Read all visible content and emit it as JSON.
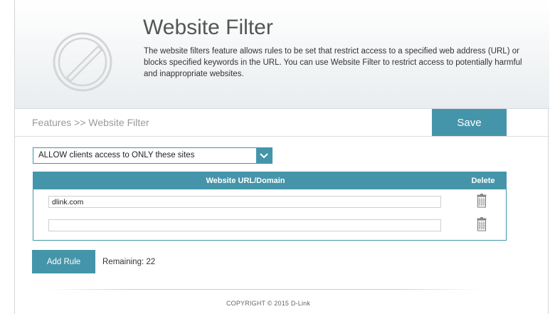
{
  "header": {
    "title": "Website Filter",
    "description": "The website filters feature allows rules to be set that restrict access to a specified web address (URL) or blocks specified keywords in the URL. You can use Website Filter to restrict access to potentially harmful and inappropriate websites.",
    "logo_icon": "prohibited-icon"
  },
  "breadcrumb": "Features >> Website Filter",
  "toolbar": {
    "save_label": "Save"
  },
  "filter_mode": {
    "selected": "ALLOW clients access to ONLY these sites",
    "arrow_icon": "chevron-down-icon"
  },
  "table": {
    "columns": [
      "Website URL/Domain",
      "Delete"
    ],
    "rows": [
      {
        "url": "dlink.com",
        "delete_icon": "trash-icon"
      },
      {
        "url": "",
        "delete_icon": "trash-icon"
      }
    ]
  },
  "actions": {
    "add_rule_label": "Add Rule",
    "remaining": "Remaining: 22"
  },
  "footer": {
    "copyright": "COPYRIGHT © 2015 D-Link"
  },
  "colors": {
    "accent": "#4595aa",
    "banner_gray": "#eef1f2"
  }
}
